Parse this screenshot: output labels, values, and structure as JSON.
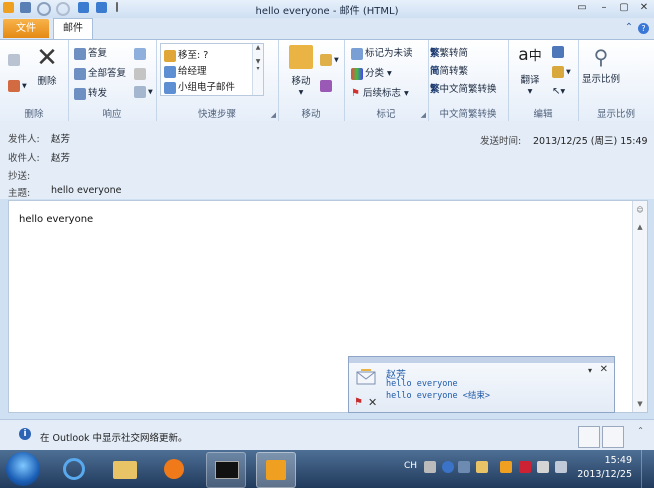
{
  "window": {
    "title": "hello everyone  -  邮件 (HTML)"
  },
  "tabs": {
    "file": "文件",
    "mail": "邮件"
  },
  "ribbon": {
    "delete_group": {
      "label": "删除",
      "delete_btn": "删除"
    },
    "respond_group": {
      "label": "响应",
      "reply": "答复",
      "reply_all": "全部答复",
      "forward": "转发"
    },
    "quick_group": {
      "label": "快速步骤",
      "items": [
        "移至: ?",
        "给经理",
        "小组电子邮件"
      ]
    },
    "move_group": {
      "label": "移动",
      "move_btn": "移动"
    },
    "tags_group": {
      "label": "标记",
      "mark_unread": "标记为未读",
      "categorize": "分类",
      "follow_up": "后续标志"
    },
    "chinese_group": {
      "label": "中文简繁转换",
      "to_simplified": "繁转简",
      "to_traditional": "简转繁",
      "convert": "中文简繁转换"
    },
    "edit_group": {
      "label": "编辑",
      "translate": "翻译"
    },
    "zoom_group": {
      "label": "显示比例",
      "zoom_btn": "显示比例"
    }
  },
  "header": {
    "from_label": "发件人:",
    "from_value": "赵芳",
    "to_label": "收件人:",
    "to_value": "赵芳",
    "cc_label": "抄送:",
    "cc_value": "",
    "subject_label": "主题:",
    "subject_value": "hello everyone",
    "sent_label": "发送时间:",
    "sent_value": "2013/12/25 (周三) 15:49"
  },
  "body": {
    "text": "hello everyone"
  },
  "alert": {
    "sender": "赵芳",
    "line1": "hello everyone",
    "line2": "hello everyone <结束>"
  },
  "social": {
    "text": "在 Outlook 中显示社交网络更新。"
  },
  "taskbar": {
    "ime": "CH",
    "time": "15:49",
    "date": "2013/12/25"
  },
  "colors": {
    "file_tab": "#e48a14",
    "accent_blue": "#2b63b5",
    "alert_text": "#1f5aa8"
  }
}
